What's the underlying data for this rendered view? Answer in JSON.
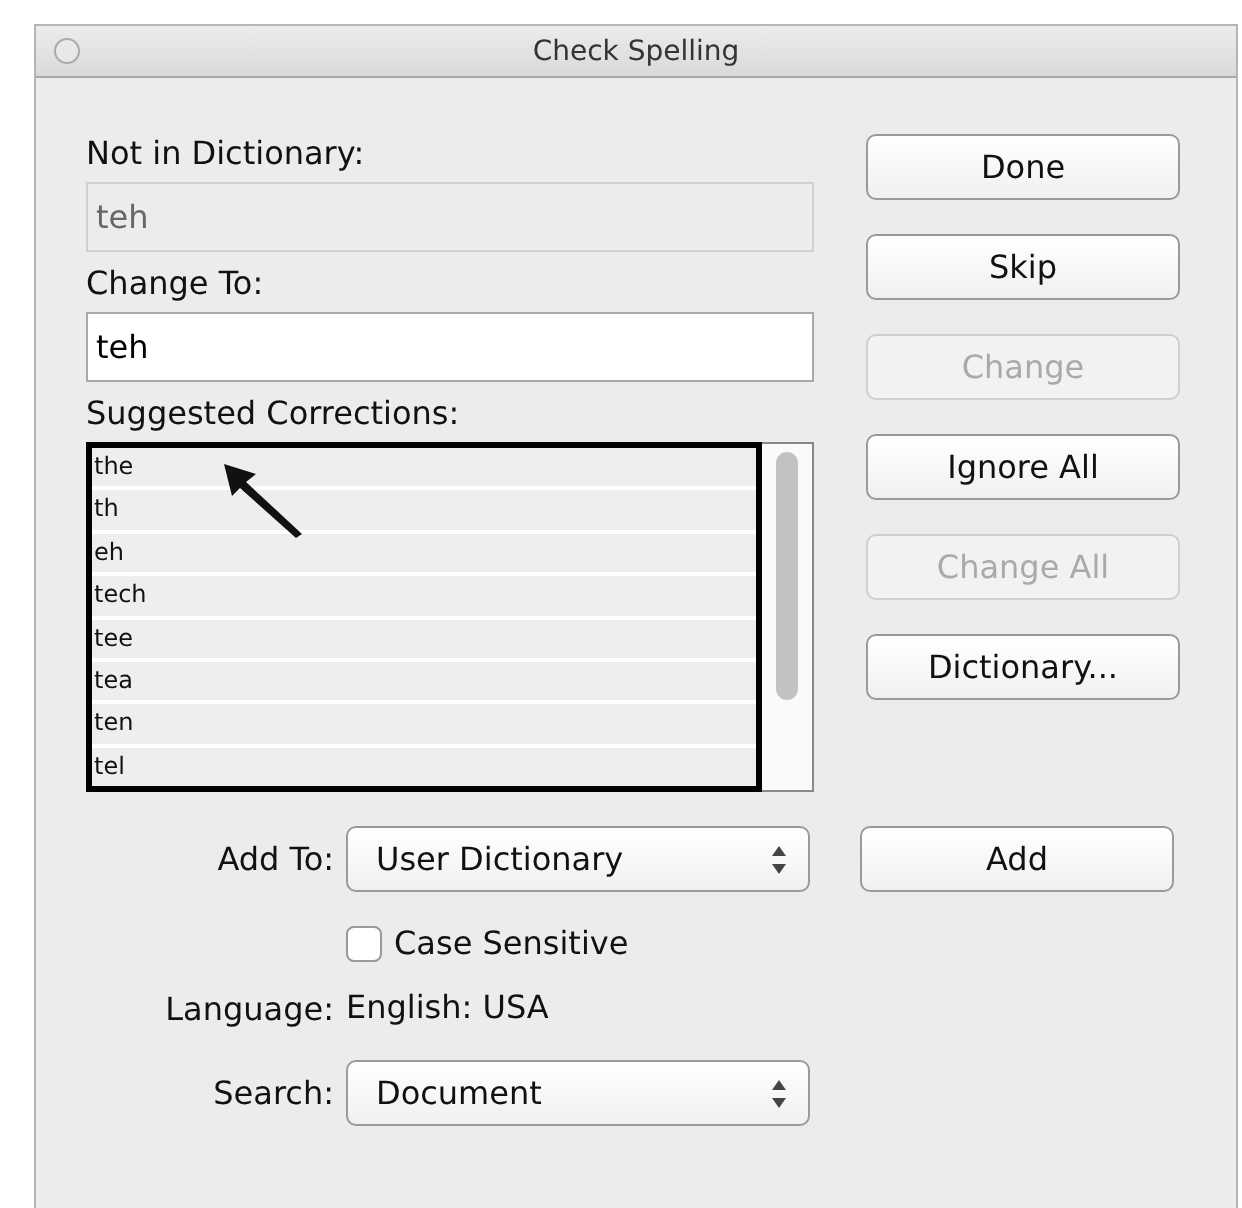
{
  "window": {
    "title": "Check Spelling"
  },
  "not_in_dictionary": {
    "label": "Not in Dictionary:",
    "value": "teh",
    "disabled": true
  },
  "change_to": {
    "label": "Change To:",
    "value": "teh",
    "disabled": false
  },
  "suggestions": {
    "label": "Suggested Corrections:",
    "items": [
      {
        "text": "the",
        "selected": false
      },
      {
        "text": "th",
        "selected": false
      },
      {
        "text": "eh",
        "selected": false
      },
      {
        "text": "tech",
        "selected": false
      },
      {
        "text": "tee",
        "selected": false
      },
      {
        "text": "tea",
        "selected": false
      },
      {
        "text": "ten",
        "selected": false
      },
      {
        "text": "tel",
        "selected": false
      }
    ]
  },
  "buttons": [
    {
      "label": "Done",
      "disabled": false
    },
    {
      "label": "Skip",
      "disabled": false
    },
    {
      "label": "Change",
      "disabled": true
    },
    {
      "label": "Ignore All",
      "disabled": false
    },
    {
      "label": "Change All",
      "disabled": true
    },
    {
      "label": "Dictionary...",
      "disabled": false
    }
  ],
  "add_to": {
    "label": "Add To:",
    "value": "User Dictionary",
    "button": "Add"
  },
  "case_sensitive": {
    "label": "Case Sensitive",
    "checked": false
  },
  "language": {
    "label": "Language:",
    "value": "English: USA"
  },
  "search": {
    "label": "Search:",
    "value": "Document"
  }
}
